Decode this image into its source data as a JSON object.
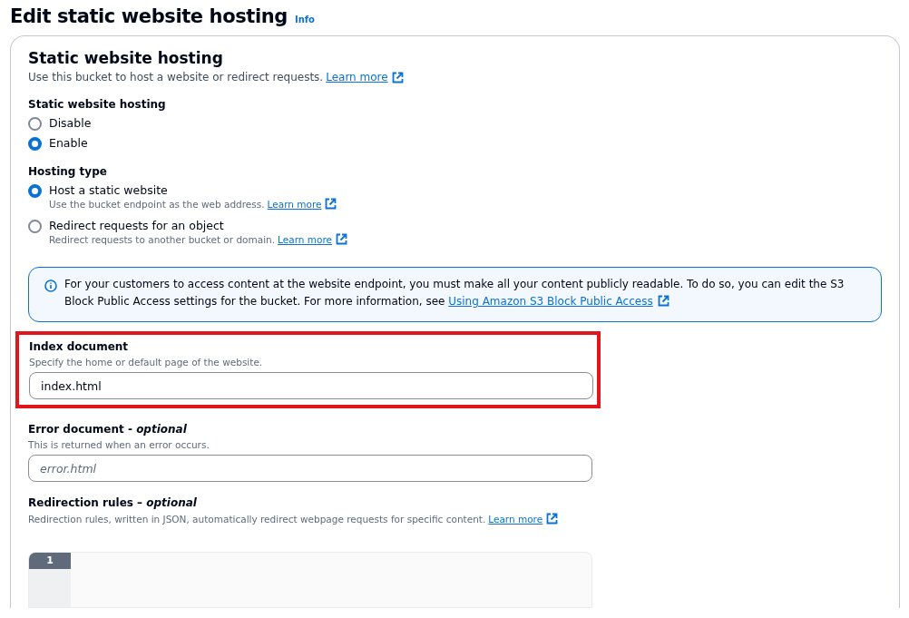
{
  "page": {
    "title": "Edit static website hosting",
    "info_link": "Info"
  },
  "section": {
    "title": "Static website hosting",
    "description": "Use this bucket to host a website or redirect requests.",
    "learn_more": "Learn more"
  },
  "radio_groups": [
    {
      "label": "Static website hosting",
      "options": [
        {
          "label": "Disable",
          "selected": false
        },
        {
          "label": "Enable",
          "selected": true
        }
      ]
    },
    {
      "label": "Hosting type",
      "options": [
        {
          "label": "Host a static website",
          "description": "Use the bucket endpoint as the web address.",
          "learn_more": "Learn more",
          "selected": true
        },
        {
          "label": "Redirect requests for an object",
          "description": "Redirect requests to another bucket or domain.",
          "learn_more": "Learn more",
          "selected": false
        }
      ]
    }
  ],
  "info_alert": {
    "text": "For your customers to access content at the website endpoint, you must make all your content publicly readable. To do so, you can edit the S3 Block Public Access settings for the bucket. For more information, see",
    "link": "Using Amazon S3 Block Public Access"
  },
  "fields": [
    {
      "label": "Index document",
      "description": "Specify the home or default page of the website.",
      "value": "index.html",
      "highlighted": true
    },
    {
      "label": "Error document - *optional*",
      "description": "This is returned when an error occurs.",
      "placeholder": "error.html"
    }
  ],
  "redirection_rules": {
    "label": "Redirection rules – *optional*",
    "description": "Redirection rules, written in JSON, automatically redirect webpage requests for specific content.",
    "learn_more": "Learn more",
    "line_numbers": [
      "1"
    ]
  }
}
